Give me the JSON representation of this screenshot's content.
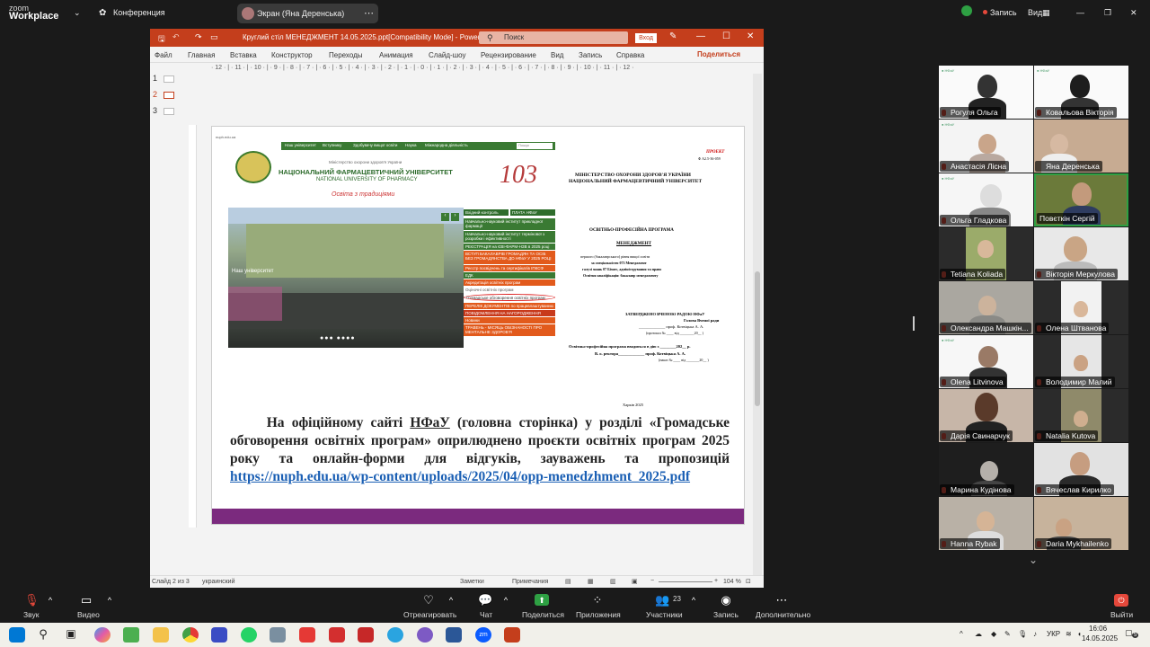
{
  "zoom": {
    "brand_line1": "zoom",
    "brand_line2": "Workplace",
    "meeting_label": "Конференция",
    "share_pill_label": "Экран (Яна Деренська)",
    "record_label": "Запись",
    "view_label": "Вид"
  },
  "ppt": {
    "title": "Круглий стіл МЕНЕДЖМЕНТ 14.05.2025.ppt[Compatibility Mode] - PowerPoint",
    "search_placeholder": "Поиск",
    "login_label": "Вход",
    "ribbon_tabs": [
      "Файл",
      "Главная",
      "Вставка",
      "Конструктор",
      "Переходы",
      "Анимация",
      "Слайд-шоу",
      "Рецензирование",
      "Вид",
      "Запись",
      "Справка"
    ],
    "share_label": "Поделиться",
    "ruler_text": "· 12 · | · 11 · | · 10 · | · 9 · | · 8 · | · 7 · | · 6 · | · 5 · | · 4 · | · 3 · | · 2 · | · 1 · | · 0 · | · 1 · | · 2 · | · 3 · | · 4 · | · 5 · | · 6 · | · 7 · | · 8 · | · 9 · | · 10 · | · 11 · | · 12 ·",
    "slide_numbers": [
      "1",
      "2",
      "3"
    ],
    "status": {
      "slide_info": "Слайд 2 из 3",
      "language": "украинский",
      "notes_label": "Заметки",
      "comments_label": "Примечания",
      "zoom_level": "104 %"
    }
  },
  "slide": {
    "website": {
      "url": "nuph.edu.ua",
      "nav_items": [
        "Наш університет",
        "Вступнику",
        "Здобувачу вищої освіти",
        "Наука",
        "Міжнародна діяльність"
      ],
      "search_placeholder": "Пошук",
      "ministry": "Міністерство охорони здоров'я України",
      "name_ua": "НАЦІОНАЛЬНИЙ ФАРМАЦЕВТИЧНИЙ УНІВЕРСИТЕТ",
      "name_en": "NATIONAL UNIVERSITY OF PHARMACY",
      "tagline": "Освіта з традиціями",
      "anniversary": "103",
      "photo_label": "Наш університет",
      "menu_top": [
        "Вхідний контроль",
        "ПЛАТА НФаУ"
      ],
      "menu_items": [
        "Навчально-науковий інститут прикладної фармації",
        "Навчально-науковий інститут термінової з розробки і ефективності",
        "РЕЄСТРАЦІЯ на ЄВІ-ФАРМ-НЗВ в 2025 році",
        "ВСТУП БАКАЛАВРІВ ГРОМАДЯН ТА ОСІБ БЕЗ ГРОМАДЯНСТВА ДО НФаУ У 2025 РОЦІ",
        "Реєстр посвідчень та сертифікатів ІПКСФ",
        "ЕДК",
        "Акредитація освітніх програм",
        "Оціночні освітніх програм",
        "Громадське обговорення освітніх програм",
        "ПЕРЕЛІК ДОКУМЕНТІВ по працевлаштуванню",
        "ПОВІДОМЛЕННЯ НА НАГОРОДЖЕННЯ",
        "Новини",
        "ТРАВЕНЬ - МІСЯЦЬ ОБІЗНАНОСТІ ПРО МЕНТАЛЬНЕ ЗДОРОВ'Я"
      ]
    },
    "document": {
      "project": "ПРОЕКТ",
      "project_num": "Ф А2.5-36-059",
      "ministry": "МІНІСТЕРСТВО ОХОРОНИ ЗДОРОВ'Я УКРАЇНИ",
      "university": "НАЦІОНАЛЬНИЙ ФАРМАЦЕВТИЧНИЙ УНІВЕРСИТЕТ",
      "program_type": "ОСВІТНЬО-ПРОФЕСІЙНА ПРОГРАМА",
      "program_name": "МЕНЕДЖМЕНТ",
      "line1": "першого (бакалаврського) рівня вищої освіти",
      "line2": "за спеціальністю 073 Менеджмент",
      "line3": "галузі знань 07 Бізнес, адміністрування та право",
      "line4": "Освітня кваліфікація: бакалавр менеджменту",
      "approved": "ЗАТВЕРДЖЕНО ВЧЕНОЮ РАДОЮ НФаУ",
      "head": "Голова Вченої ради",
      "head_sign": "_____________ проф. Котвіцька А. А.",
      "protocol": "(протокол № ____ від ________20__ )",
      "effective": "Освітньо-професійна програма вводиться в дію з ________202__ р.",
      "rector": "В. о. ректора_____________ проф. Котвіцька А. А.",
      "order": "(наказ № ____ від _______20__ )",
      "city": "Харків 2025"
    },
    "caption_part1": "На офіційному сайті ",
    "caption_underline": "НФаУ",
    "caption_part2": " (головна сторінка) у розділі «Громадське обговорення освітніх програм» оприлюднено проєкти освітніх програм 2025 року та онлайн-форми для відгуків, зауважень та пропозицій ",
    "caption_link": "https://nuph.edu.ua/wp-content/uploads/2025/04/opp-menedzhment_2025.pdf"
  },
  "participants": [
    "Рогуля Ольга",
    "Ковальова Вікторія",
    "Анастасія Лісна",
    "Яна Деренська",
    "Ольга Гладкова",
    "Повєткін Сергій",
    "Tetiana Koliada",
    "Вікторія Меркулова",
    "Олександра Машкін...",
    "Олена Штванова",
    "Olena Litvinova",
    "Володимир Малий",
    "Дарія Свинарчук",
    "Natalia Kutova",
    "Марина Кудінова",
    "Вячеслав Кирилко",
    "Hanna Rybak",
    "Daria Mykhailenko"
  ],
  "toolbar": {
    "audio": "Звук",
    "video": "Видео",
    "react": "Отреагировать",
    "chat": "Чат",
    "share": "Поделиться",
    "apps": "Приложения",
    "participants": "Участники",
    "participants_count": "23",
    "record": "Запись",
    "more": "Дополнительно",
    "leave": "Выйти"
  },
  "taskbar": {
    "lang": "УКР",
    "time": "16:06",
    "date": "14.05.2025",
    "notif_count": "5"
  }
}
